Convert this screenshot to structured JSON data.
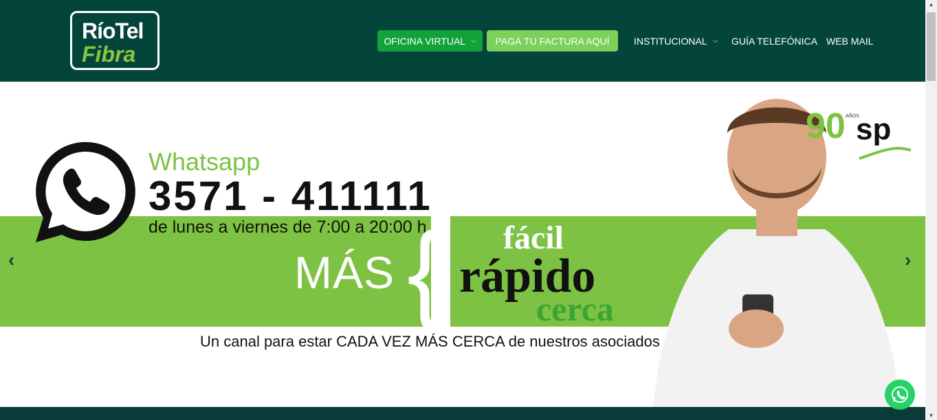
{
  "header": {
    "logo_line1": "RíoTel",
    "logo_line2": "Fibra",
    "nav": {
      "oficina_virtual": "OFICINA VIRTUAL",
      "paga_factura": "PAGÁ TU FACTURA AQUÍ",
      "institucional": "INSTITUCIONAL",
      "guia": "GUÍA TELEFÓNICA",
      "webmail": "WEB MAIL"
    }
  },
  "hero": {
    "wa_title": "Whatsapp",
    "wa_number": "3571 - 411111",
    "wa_hours": "de lunes a viernes de 7:00 a 20:00 h",
    "mas": "MÁS",
    "word1": "fácil",
    "word2": "rápido",
    "word3": "cerca",
    "tagline": "Un canal para estar CADA VEZ MÁS CERCA de nuestros asociados",
    "badge_text": "90",
    "badge_small": "AÑOS",
    "badge_sp": "sp"
  },
  "icons": {
    "prev": "chevron-left-icon",
    "next": "chevron-right-icon",
    "whatsapp": "whatsapp-icon"
  },
  "colors": {
    "header_bg": "#04453b",
    "green_band": "#7dc242",
    "btn_dark": "#11a33a",
    "btn_light": "#7cd15a",
    "footer": "#0c3a3b"
  }
}
